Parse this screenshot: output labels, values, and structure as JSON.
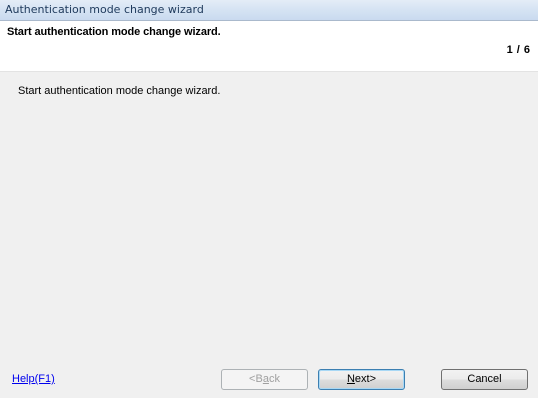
{
  "window": {
    "title": "Authentication mode change wizard"
  },
  "header": {
    "title": "Start authentication mode change wizard.",
    "step_counter": "1 / 6"
  },
  "content": {
    "description": "Start authentication mode change wizard."
  },
  "footer": {
    "help_link": "Help(F1)",
    "back_button": {
      "prefix": "<B",
      "mnemonic": "a",
      "suffix": "ck",
      "enabled": false
    },
    "next_button": {
      "prefix": "",
      "mnemonic": "N",
      "suffix": "ext>",
      "enabled": true
    },
    "cancel_button": {
      "label": "Cancel",
      "enabled": true
    }
  }
}
